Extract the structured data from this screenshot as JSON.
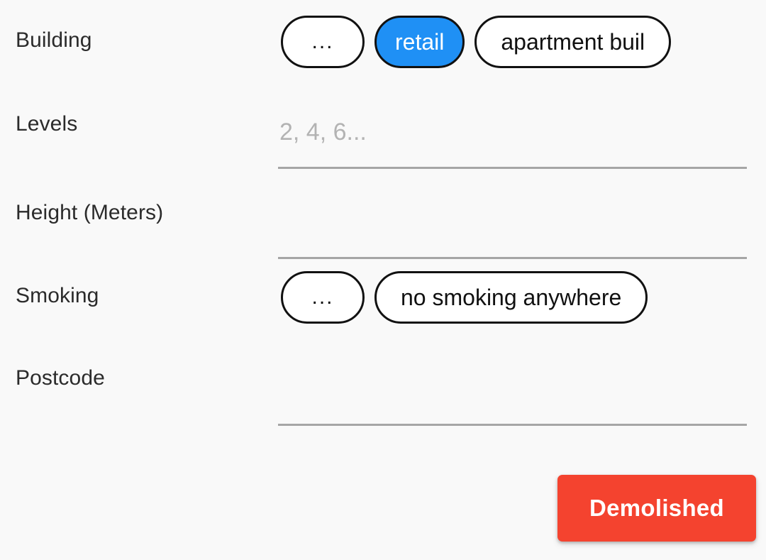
{
  "form": {
    "background_color": "#f9f9f9",
    "accent_color": "#1f90f5",
    "danger_color": "#f4432f",
    "rows": [
      {
        "label": "Building",
        "type": "chips",
        "chips": [
          {
            "label": "...",
            "selected": false,
            "kind": "ellipsis"
          },
          {
            "label": "retail",
            "selected": true,
            "kind": "normal"
          },
          {
            "label": "apartment buil",
            "selected": false,
            "kind": "wide",
            "clipped": true
          }
        ]
      },
      {
        "label": "Levels",
        "type": "text",
        "value": "",
        "placeholder": "2, 4, 6..."
      },
      {
        "label": "Height (Meters)",
        "type": "text",
        "value": "",
        "placeholder": ""
      },
      {
        "label": "Smoking",
        "type": "chips",
        "chips": [
          {
            "label": "...",
            "selected": false,
            "kind": "ellipsis"
          },
          {
            "label": "no smoking anywhere",
            "selected": false,
            "kind": "wide"
          }
        ]
      },
      {
        "label": "Postcode",
        "type": "text",
        "value": "",
        "placeholder": ""
      }
    ],
    "actions": {
      "demolished_label": "Demolished"
    }
  }
}
